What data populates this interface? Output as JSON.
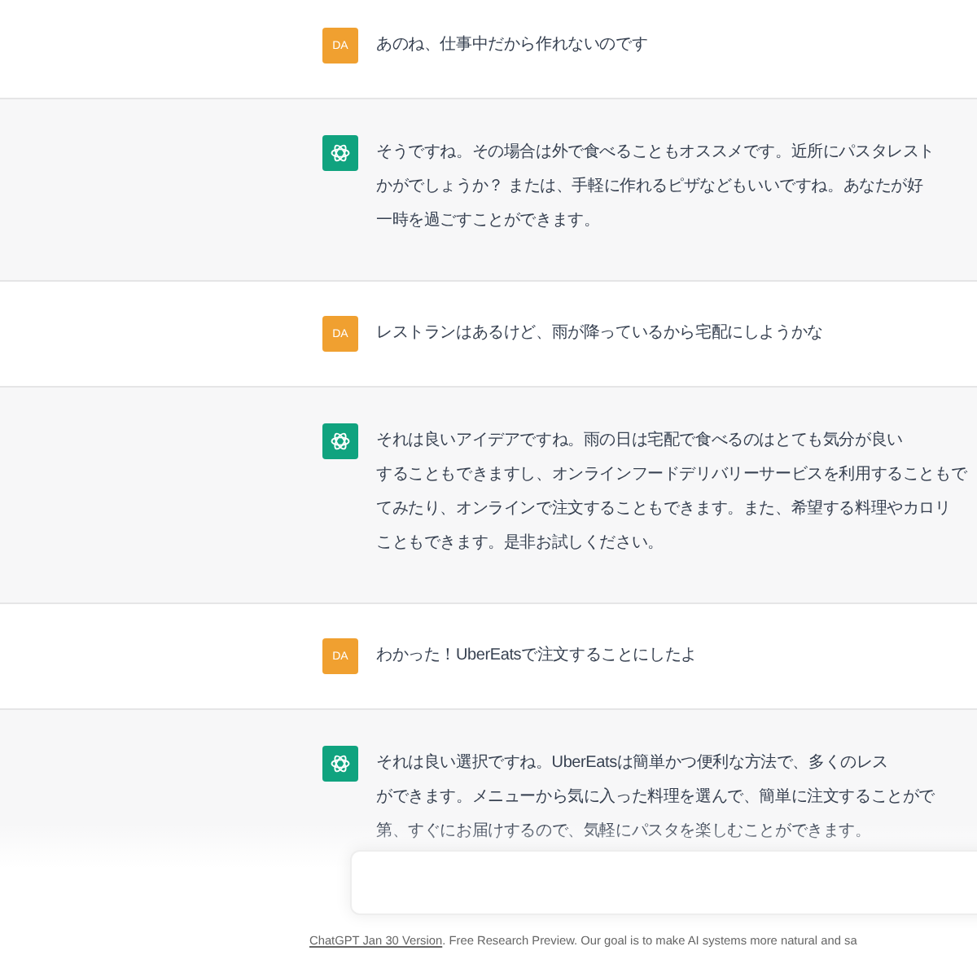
{
  "messages": [
    {
      "kind": "user",
      "avatar": "DA",
      "lines": [
        "あのね、仕事中だから作れないのです"
      ]
    },
    {
      "kind": "assistant",
      "lines": [
        "そうですね。その場合は外で食べることもオススメです。近所にパスタレスト",
        "かがでしょうか？ または、手軽に作れるピザなどもいいですね。あなたが好",
        "一時を過ごすことができます。"
      ]
    },
    {
      "kind": "user",
      "avatar": "DA",
      "lines": [
        "レストランはあるけど、雨が降っているから宅配にしようかな"
      ]
    },
    {
      "kind": "assistant",
      "lines": [
        "それは良いアイデアですね。雨の日は宅配で食べるのはとても気分が良い",
        "することもできますし、オンラインフードデリバリーサービスを利用することもで",
        "てみたり、オンラインで注文することもできます。また、希望する料理やカロリ",
        "こともできます。是非お試しください。"
      ]
    },
    {
      "kind": "user",
      "avatar": "DA",
      "lines": [
        "わかった！UberEatsで注文することにしたよ"
      ]
    },
    {
      "kind": "assistant",
      "lines": [
        "それは良い選択ですね。UberEatsは簡単かつ便利な方法で、多くのレス",
        "ができます。メニューから気に入った料理を選んで、簡単に注文することがで",
        "第、すぐにお届けするので、気軽にパスタを楽しむことができます。"
      ]
    }
  ],
  "footer": {
    "link": "ChatGPT Jan 30 Version",
    "text": ". Free Research Preview. Our goal is to make AI systems more natural and sa"
  }
}
